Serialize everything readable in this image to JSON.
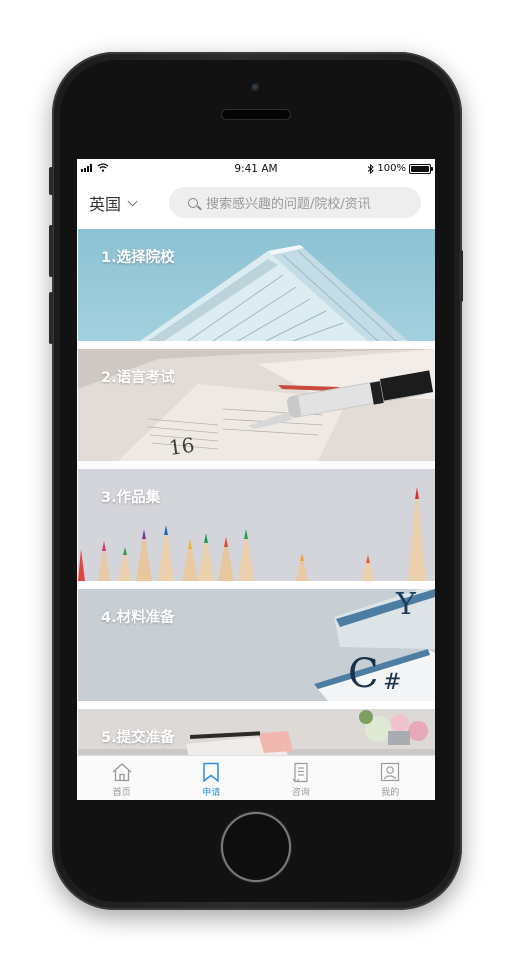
{
  "status_bar": {
    "time": "9:41 AM",
    "battery_text": "100%"
  },
  "header": {
    "region": "英国",
    "search_placeholder": "搜索感兴趣的问题/院校/资讯"
  },
  "steps": [
    {
      "label": "1.选择院校",
      "image": "building-icon"
    },
    {
      "label": "2.语言考试",
      "image": "pen-notebook-icon"
    },
    {
      "label": "3.作品集",
      "image": "pencils-icon"
    },
    {
      "label": "4.材料准备",
      "image": "magazines-icon"
    },
    {
      "label": "5.提交准备",
      "image": "desk-icon"
    }
  ],
  "tab_bar": {
    "items": [
      {
        "label": "首页",
        "icon": "home-icon",
        "active": false
      },
      {
        "label": "申请",
        "icon": "bookmark-icon",
        "active": true
      },
      {
        "label": "咨询",
        "icon": "document-icon",
        "active": false
      },
      {
        "label": "我的",
        "icon": "profile-icon",
        "active": false
      }
    ],
    "active_color": "#2b8fe0",
    "inactive_color": "#999999"
  }
}
